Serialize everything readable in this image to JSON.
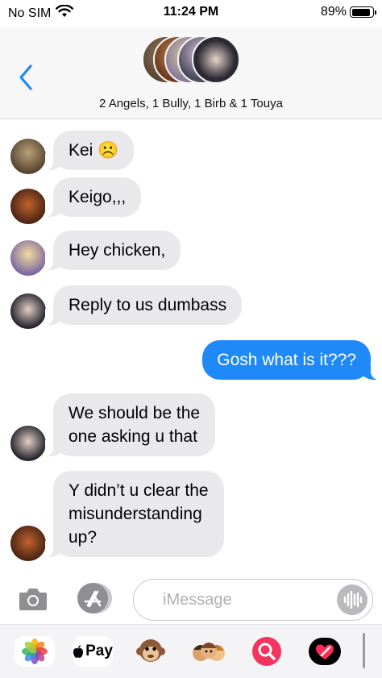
{
  "status_bar": {
    "carrier": "No SIM",
    "time": "11:24 PM",
    "battery_percent_label": "89%",
    "battery_level": 0.89
  },
  "header": {
    "group_title": "2 Angels, 1 Bully, 1 Birb & 1 Touya"
  },
  "messages": [
    {
      "direction": "received",
      "text": "Kei ☹️"
    },
    {
      "direction": "received",
      "text": "Keigo,,,"
    },
    {
      "direction": "received",
      "text": "Hey chicken,"
    },
    {
      "direction": "received",
      "text": "Reply to us dumbass"
    },
    {
      "direction": "sent",
      "text": "Gosh what is it???"
    },
    {
      "direction": "received",
      "text": "We should be the\none asking u that"
    },
    {
      "direction": "received",
      "text": "Y didn’t u clear the\nmisunderstanding\nup?"
    }
  ],
  "composer": {
    "placeholder": "iMessage"
  },
  "app_drawer": {
    "apple_pay_label": "Pay",
    "icons": [
      "photos-icon",
      "apple-pay-icon",
      "animoji-icon",
      "memoji-icon",
      "image-search-icon",
      "digital-touch-icon"
    ]
  },
  "colors": {
    "sent_bubble": "#1f8af7",
    "received_bubble": "#e9e9eb",
    "accent": "#1f8af7"
  }
}
